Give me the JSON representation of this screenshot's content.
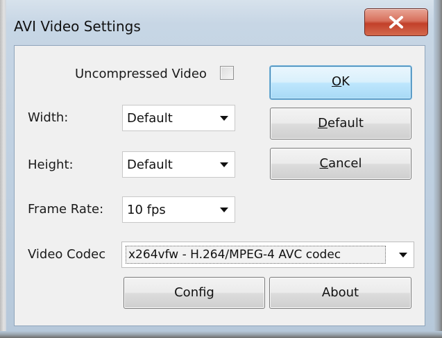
{
  "window": {
    "title": "AVI Video Settings"
  },
  "options": {
    "uncompressed_label": "Uncompressed Video",
    "uncompressed_checked": false,
    "width_label": "Width:",
    "width_value": "Default",
    "height_label": "Height:",
    "height_value": "Default",
    "framerate_label": "Frame Rate:",
    "framerate_value": "10 fps",
    "codec_label": "Video Codec",
    "codec_value": "x264vfw - H.264/MPEG-4 AVC codec"
  },
  "buttons": {
    "ok": {
      "mnemonic": "O",
      "rest": "K"
    },
    "default": {
      "mnemonic": "D",
      "rest": "efault"
    },
    "cancel": {
      "mnemonic": "C",
      "rest": "ancel"
    },
    "config": "Config",
    "about": "About"
  },
  "icons": {
    "close": "close-icon",
    "dropdown": "chevron-down-icon"
  },
  "colors": {
    "frame": "#bfd0e1",
    "panel": "#f0f0f0",
    "close_red": "#c2402a",
    "ok_blue": "#bee6fd"
  }
}
